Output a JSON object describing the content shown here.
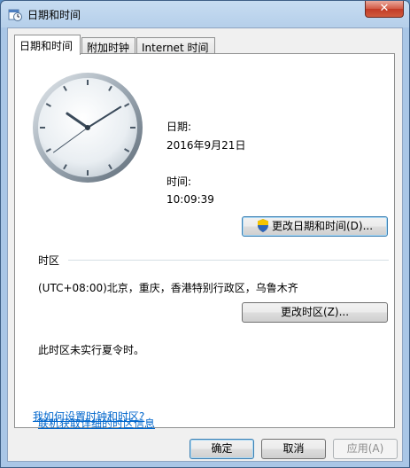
{
  "window": {
    "title": "日期和时间",
    "close_label": "✕"
  },
  "tabs": [
    {
      "label": "日期和时间"
    },
    {
      "label": "附加时钟"
    },
    {
      "label": "Internet 时间"
    }
  ],
  "datetime": {
    "date_label": "日期:",
    "date_value": "2016年9月21日",
    "time_label": "时间:",
    "time_value": "10:09:39",
    "change_button": "更改日期和时间(D)..."
  },
  "timezone": {
    "section_label": "时区",
    "value": "(UTC+08:00)北京，重庆，香港特别行政区，乌鲁木齐",
    "change_button": "更改时区(Z)...",
    "dst_note": "此时区未实行夏令时。"
  },
  "links": {
    "online_info": "联机获取详细的时区信息",
    "how_to": "我如何设置时钟和时区?"
  },
  "dialog_buttons": {
    "ok": "确定",
    "cancel": "取消",
    "apply": "应用(A)"
  },
  "clock": {
    "hour": 10,
    "minute": 9,
    "second": 39
  },
  "colors": {
    "link": "#0066cc",
    "title_bar": "#b5cfea",
    "close": "#c23b26"
  }
}
